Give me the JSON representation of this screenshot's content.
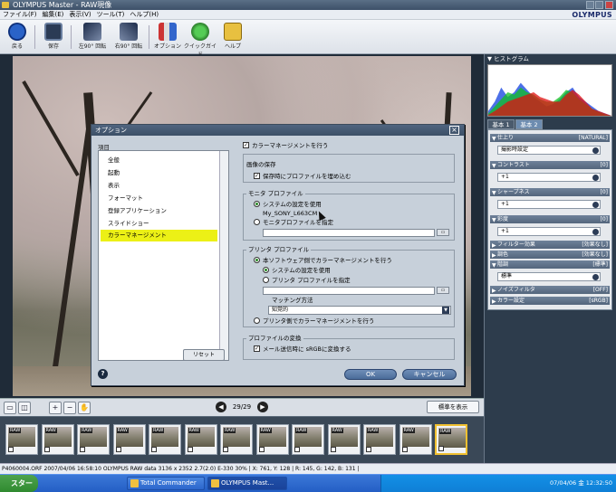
{
  "window": {
    "title": "OLYMPUS Master - RAW現像",
    "brand": "OLYMPUS"
  },
  "menu": [
    "ファイル(F)",
    "編集(E)",
    "表示(V)",
    "ツール(T)",
    "ヘルプ(H)"
  ],
  "toolbar": {
    "back": "戻る",
    "save": "保存",
    "rot_left": "左90° 回転",
    "rot_right": "右90° 回転",
    "option": "オプション",
    "quick_guide": "クイックガイド",
    "help": "ヘルプ"
  },
  "colors": {
    "accent": "#ecf016",
    "dialog_bg": "#c7d0da",
    "panel": "#2d3c4c",
    "title": "#3c4f66"
  },
  "navigator": {
    "page": "29/29",
    "standard_button": "標準を表示"
  },
  "thumbnails": {
    "tag": "RAW",
    "count": 13
  },
  "status": "P4060004.ORF 2007/04/06 16:58:10 OLYMPUS RAW data 3136 x 2352 2.7(2.0) E-330 30% | X: 761, Y: 128 | R: 145, G: 142, B: 131 |",
  "taskbar": {
    "start": "スタート",
    "tasks": [
      "Total Commander",
      "OLYMPUS Mast..."
    ],
    "clock": "07/04/06 金 12:32:50"
  },
  "histogram": {
    "title": "ヒストグラム",
    "channels": [
      {
        "color": "#1040e0",
        "levels": [
          0.1,
          0.3,
          0.6,
          0.4,
          0.5,
          0.7,
          0.55,
          0.4,
          0.3,
          0.2,
          0.25,
          0.35,
          0.5,
          0.6,
          0.4,
          0.3,
          0.2,
          0.1,
          0.05,
          0.0
        ]
      },
      {
        "color": "#10c020",
        "levels": [
          0.05,
          0.2,
          0.35,
          0.5,
          0.45,
          0.6,
          0.5,
          0.45,
          0.35,
          0.3,
          0.3,
          0.4,
          0.55,
          0.5,
          0.35,
          0.25,
          0.15,
          0.08,
          0.03,
          0.0
        ]
      },
      {
        "color": "#e01010",
        "levels": [
          0.02,
          0.1,
          0.2,
          0.3,
          0.35,
          0.4,
          0.45,
          0.5,
          0.4,
          0.35,
          0.3,
          0.3,
          0.45,
          0.55,
          0.45,
          0.3,
          0.15,
          0.1,
          0.05,
          0.0
        ]
      }
    ]
  },
  "right_tabs": [
    "基本 1",
    "基本 2"
  ],
  "adjust": {
    "finish": {
      "label": "仕上り",
      "value": "[NATURAL]",
      "select": "撮影時設定"
    },
    "contrast": {
      "label": "コントラスト",
      "value": "[0]",
      "select": "+1"
    },
    "sharpness": {
      "label": "シャープネス",
      "value": "[0]",
      "select": "+1"
    },
    "saturation": {
      "label": "彩度",
      "value": "[0]",
      "select": "+1"
    },
    "filter": {
      "label": "フィルター効果",
      "value": "[効果なし]"
    },
    "tone": {
      "label": "調色",
      "value": "[効果なし]"
    },
    "gradation": {
      "label": "階調",
      "value": "[標準]",
      "select": "標準"
    },
    "noise": {
      "label": "ノイズフィルタ",
      "value": "[OFF]"
    },
    "colorspace": {
      "label": "カラー設定",
      "value": "[sRGB]"
    }
  },
  "dialog": {
    "title": "オプション",
    "items_header": "項目",
    "items": [
      "全般",
      "起動",
      "表示",
      "フォーマット",
      "登録アプリケーション",
      "スライドショー",
      "カラーマネージメント"
    ],
    "selected_item": "カラーマネージメント",
    "reset": "リセット",
    "use_cm": "カラーマネージメントを行う",
    "image_save": "画像の保存",
    "embed_profile": "保存時にプロファイルを埋め込む",
    "monitor_profile": "モニタ プロファイル",
    "use_system": "システムの設定を使用",
    "system_profile": "My_SONY_L663CM",
    "specify_monitor": "モニタプロファイルを指定",
    "printer_profile": "プリンタ プロファイル",
    "software_cm": "本ソフトウェア側でカラーマネージメントを行う",
    "use_system2": "システムの設定を使用",
    "specify_printer": "プリンタ プロファイルを指定",
    "matching": "マッチング方法",
    "matching_value": "知覚的",
    "printer_cm": "プリンタ側でカラーマネージメントを行う",
    "profile_convert": "プロファイルの変換",
    "mail_srgb": "メール送信時に sRGBに変換する",
    "ok": "OK",
    "cancel": "キャンセル"
  }
}
